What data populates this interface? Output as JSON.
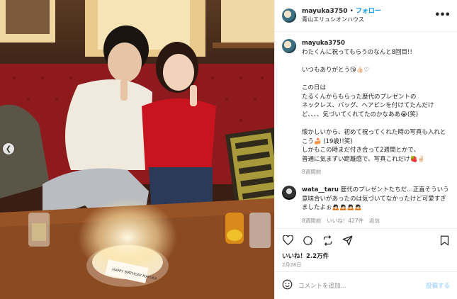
{
  "post": {
    "username": "mayuka3750",
    "dot": "•",
    "follow_label": "フォロー",
    "location": "青山エリュシオンハウス",
    "more_icon": "more-icon",
    "prev_icon": "chevron-left-icon"
  },
  "caption": {
    "username": "mayuka3750",
    "para1": "わたくんに祝ってもらうのなんと8回目!!",
    "para2": "いつもありがとう😘👍🏻♡",
    "para3": "この日は\nたるくんからもらった歴代のプレゼントの\nネックレス、バッグ、ヘアピンを付けてたんだけど、、、、気づいてくれてたのかなああ😭(笑)",
    "para4": "懐かしいから、初めて祝ってくれた時の写真も入れとこう🍰 (19歳!!笑)\nしかもこの時まだ付き合って2週間とかで、\n普通に気まずい距離感で、写真これだけ🍓✌🏻",
    "time": "8週間前"
  },
  "reply": {
    "username": "wata__taru",
    "text": "歴代のプレゼントたちだ…正直そういう意味合いがあったのは気づいてなかったけど可愛すぎましたよぉ🙇🏻🙇🏻🙇🏻🙇🏻",
    "time": "8週間前",
    "likes": "いいね！427件",
    "reply_label": "返信"
  },
  "actions": {
    "like_icon": "heart-icon",
    "comment_icon": "comment-icon",
    "repost_icon": "repost-icon",
    "share_icon": "share-icon",
    "save_icon": "bookmark-icon"
  },
  "likes_text": "いいね！2.2万件",
  "date_text": "2月28日",
  "comment_box": {
    "placeholder": "コメントを追加...",
    "post_label": "投稿する",
    "emoji_icon": "emoji-icon"
  },
  "photo": {
    "cake_text": "HAPPY BIRTHDAY MAYUKA"
  }
}
